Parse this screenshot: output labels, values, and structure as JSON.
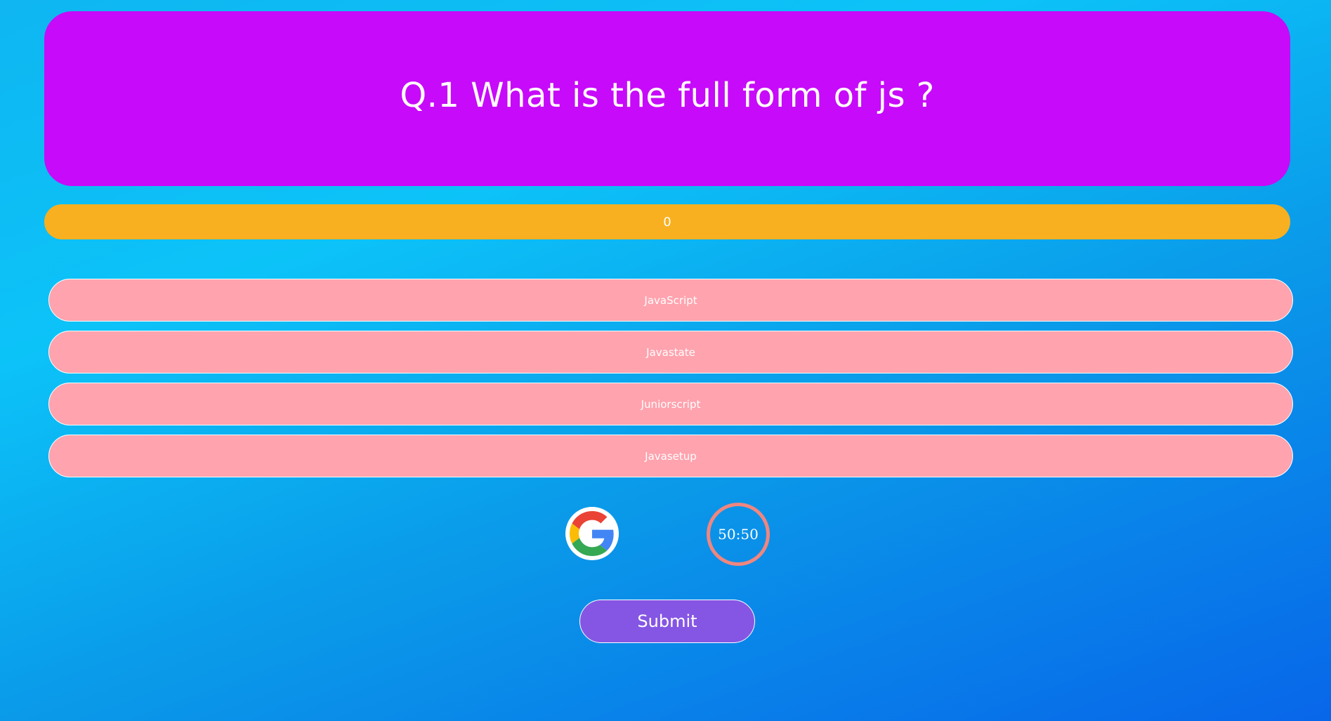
{
  "question": {
    "text": "Q.1 What is the full form of js ?"
  },
  "score": {
    "value": "0"
  },
  "options": [
    {
      "label": "JavaScript"
    },
    {
      "label": "Javastate"
    },
    {
      "label": "Juniorscript"
    },
    {
      "label": "Javasetup"
    }
  ],
  "lifelines": {
    "google_icon": "google-icon",
    "fifty_fifty_label": "50:50"
  },
  "submit": {
    "label": "Submit"
  },
  "colors": {
    "question_bg": "#c70af9",
    "score_bar": "#f8b020",
    "option_bg": "#ffa3ae",
    "fifty_ring": "#f0867f",
    "submit_bg": "#8556e3"
  }
}
